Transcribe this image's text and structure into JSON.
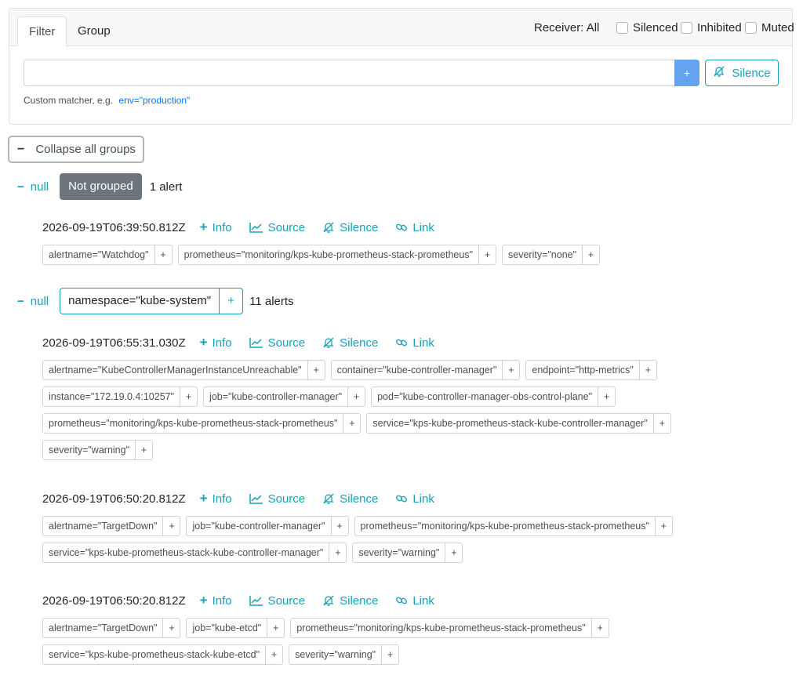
{
  "tabs": {
    "filter": "Filter",
    "group": "Group"
  },
  "receiver": "Receiver: All",
  "checkboxes": {
    "silenced": "Silenced",
    "inhibited": "Inhibited",
    "muted": "Muted"
  },
  "filter": {
    "input_value": "",
    "plus_label": "+",
    "silence_label": "Silence",
    "hint": "Custom matcher, e.g.",
    "hint_example": "env=\"production\""
  },
  "collapse_all_label": "Collapse all groups",
  "groups": [
    {
      "toggle": "null",
      "label": "Not grouped",
      "count": "1 alert",
      "alerts": [
        {
          "timestamp": "2026-09-19T06:39:50.812Z",
          "labels": [
            "alertname=\"Watchdog\"",
            "prometheus=\"monitoring/kps-kube-prometheus-stack-prometheus\"",
            "severity=\"none\""
          ]
        }
      ]
    },
    {
      "toggle": "null",
      "label": "namespace=\"kube-system\"",
      "count": "11 alerts",
      "alerts": [
        {
          "timestamp": "2026-09-19T06:55:31.030Z",
          "labels": [
            "alertname=\"KubeControllerManagerInstanceUnreachable\"",
            "container=\"kube-controller-manager\"",
            "endpoint=\"http-metrics\"",
            "instance=\"172.19.0.4:10257\"",
            "job=\"kube-controller-manager\"",
            "pod=\"kube-controller-manager-obs-control-plane\"",
            "prometheus=\"monitoring/kps-kube-prometheus-stack-prometheus\"",
            "service=\"kps-kube-prometheus-stack-kube-controller-manager\"",
            "severity=\"warning\""
          ]
        },
        {
          "timestamp": "2026-09-19T06:50:20.812Z",
          "labels": [
            "alertname=\"TargetDown\"",
            "job=\"kube-controller-manager\"",
            "prometheus=\"monitoring/kps-kube-prometheus-stack-prometheus\"",
            "service=\"kps-kube-prometheus-stack-kube-controller-manager\"",
            "severity=\"warning\""
          ]
        },
        {
          "timestamp": "2026-09-19T06:50:20.812Z",
          "labels": [
            "alertname=\"TargetDown\"",
            "job=\"kube-etcd\"",
            "prometheus=\"monitoring/kps-kube-prometheus-stack-prometheus\"",
            "service=\"kps-kube-prometheus-stack-kube-etcd\"",
            "severity=\"warning\""
          ]
        }
      ]
    }
  ],
  "actions": {
    "info": "Info",
    "source": "Source",
    "silence": "Silence",
    "link": "Link"
  },
  "colors": {
    "accent": "#17a2b8",
    "primary_button": "#66a3ef",
    "badge": "#6c757d"
  }
}
